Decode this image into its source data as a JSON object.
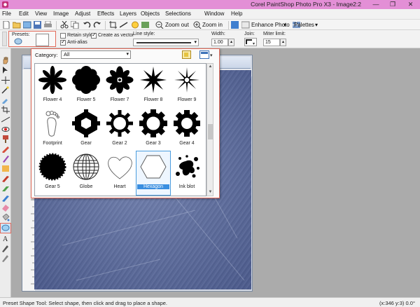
{
  "window": {
    "title": "Corel PaintShop Photo Pro X3 - Image2:2",
    "minimize": "—",
    "restore": "❐",
    "close": "✕"
  },
  "menu": [
    "File",
    "Edit",
    "View",
    "Image",
    "Adjust",
    "Effects",
    "Layers",
    "Objects",
    "Selections",
    "Window",
    "Help"
  ],
  "toolbar": {
    "zoom_out": "Zoom out",
    "zoom_in": "Zoom in",
    "enhance_photo": "Enhance Photo",
    "palettes": "Palettes"
  },
  "options": {
    "presets_label": "Presets:",
    "retain_style": "Retain style",
    "create_as_vector": "Create as vector",
    "anti_alias": "Anti-alias",
    "line_style_label": "Line style:",
    "width_label": "Width:",
    "width_value": "1.00",
    "join_label": "Join:",
    "miter_label": "Miter limit:",
    "miter_value": "15",
    "retain_style_checked": false,
    "create_as_vector_checked": true,
    "anti_alias_checked": true
  },
  "popup": {
    "category_label": "Category:",
    "category_value": "All",
    "selected": "Hexagon",
    "shapes": [
      {
        "name": "Flower 4"
      },
      {
        "name": "Flower 5"
      },
      {
        "name": "Flower 7"
      },
      {
        "name": "Flower 8"
      },
      {
        "name": "Flower 9"
      },
      {
        "name": "Footprint"
      },
      {
        "name": "Gear"
      },
      {
        "name": "Gear 2"
      },
      {
        "name": "Gear 3"
      },
      {
        "name": "Gear 4"
      },
      {
        "name": "Gear 5"
      },
      {
        "name": "Globe"
      },
      {
        "name": "Heart"
      },
      {
        "name": "Hexagon"
      },
      {
        "name": "Ink blot"
      }
    ]
  },
  "status": {
    "hint": "Preset Shape Tool: Select shape, then click and drag to place a shape.",
    "coords": "(x:346 y:3) 0.0°"
  },
  "colors": {
    "title_bar": "#e38fd6",
    "accent_border": "#e36b5a",
    "selection_blue": "#3a8ee0",
    "canvas_denim": "#5a6a9a"
  }
}
